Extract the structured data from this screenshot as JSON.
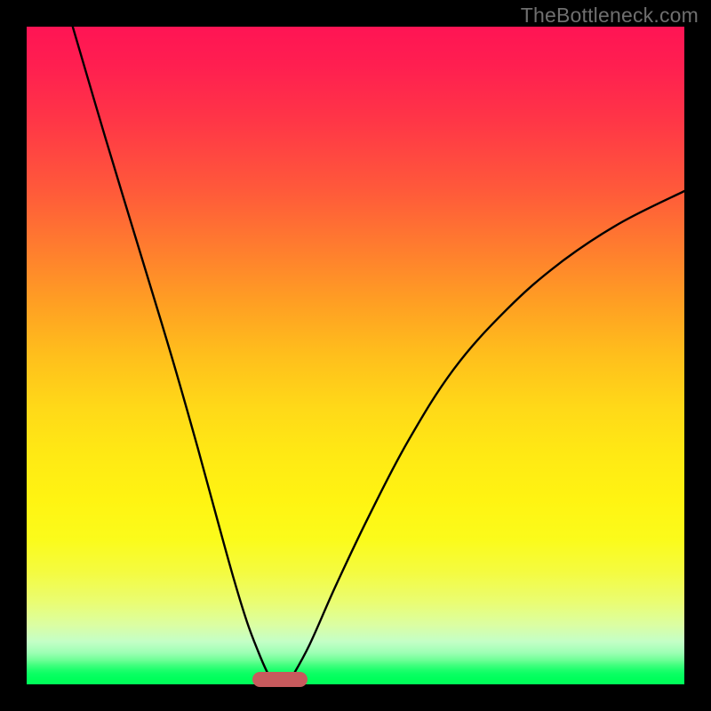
{
  "watermark": "TheBottleneck.com",
  "colors": {
    "frame": "#000000",
    "pill": "#c75a5d",
    "curve": "#000000"
  },
  "chart_data": {
    "type": "line",
    "title": "",
    "xlabel": "",
    "ylabel": "",
    "xlim": [
      0,
      1
    ],
    "ylim": [
      0,
      1
    ],
    "note": "Axes are unlabeled; values are normalized 0–1 estimates read off the image. The curve is a V-shape touching y≈0 (the green band) near x≈0.37 and rising steeply to both sides. Left arm reaches y=1 around x≈0.07; right arm reaches y≈0.75 at x=1.",
    "series": [
      {
        "name": "left_arm",
        "x": [
          0.07,
          0.12,
          0.17,
          0.22,
          0.26,
          0.29,
          0.315,
          0.335,
          0.352,
          0.365,
          0.374
        ],
        "y": [
          1.0,
          0.83,
          0.665,
          0.5,
          0.36,
          0.25,
          0.16,
          0.095,
          0.05,
          0.02,
          0.005
        ]
      },
      {
        "name": "right_arm",
        "x": [
          0.4,
          0.43,
          0.47,
          0.52,
          0.58,
          0.65,
          0.73,
          0.81,
          0.9,
          1.0
        ],
        "y": [
          0.005,
          0.06,
          0.15,
          0.255,
          0.37,
          0.48,
          0.57,
          0.64,
          0.7,
          0.75
        ]
      }
    ],
    "marker": {
      "shape": "rounded_rect",
      "center_x": 0.385,
      "center_y": 0.007,
      "width": 0.084,
      "height": 0.023,
      "color": "#c75a5d"
    },
    "background_gradient": {
      "direction": "top_to_bottom",
      "stops": [
        {
          "pos": 0.0,
          "color": "#ff1454"
        },
        {
          "pos": 0.34,
          "color": "#ff7e2e"
        },
        {
          "pos": 0.58,
          "color": "#ffd918"
        },
        {
          "pos": 0.83,
          "color": "#f4fb41"
        },
        {
          "pos": 0.95,
          "color": "#9dffb4"
        },
        {
          "pos": 1.0,
          "color": "#00ff59"
        }
      ]
    }
  }
}
